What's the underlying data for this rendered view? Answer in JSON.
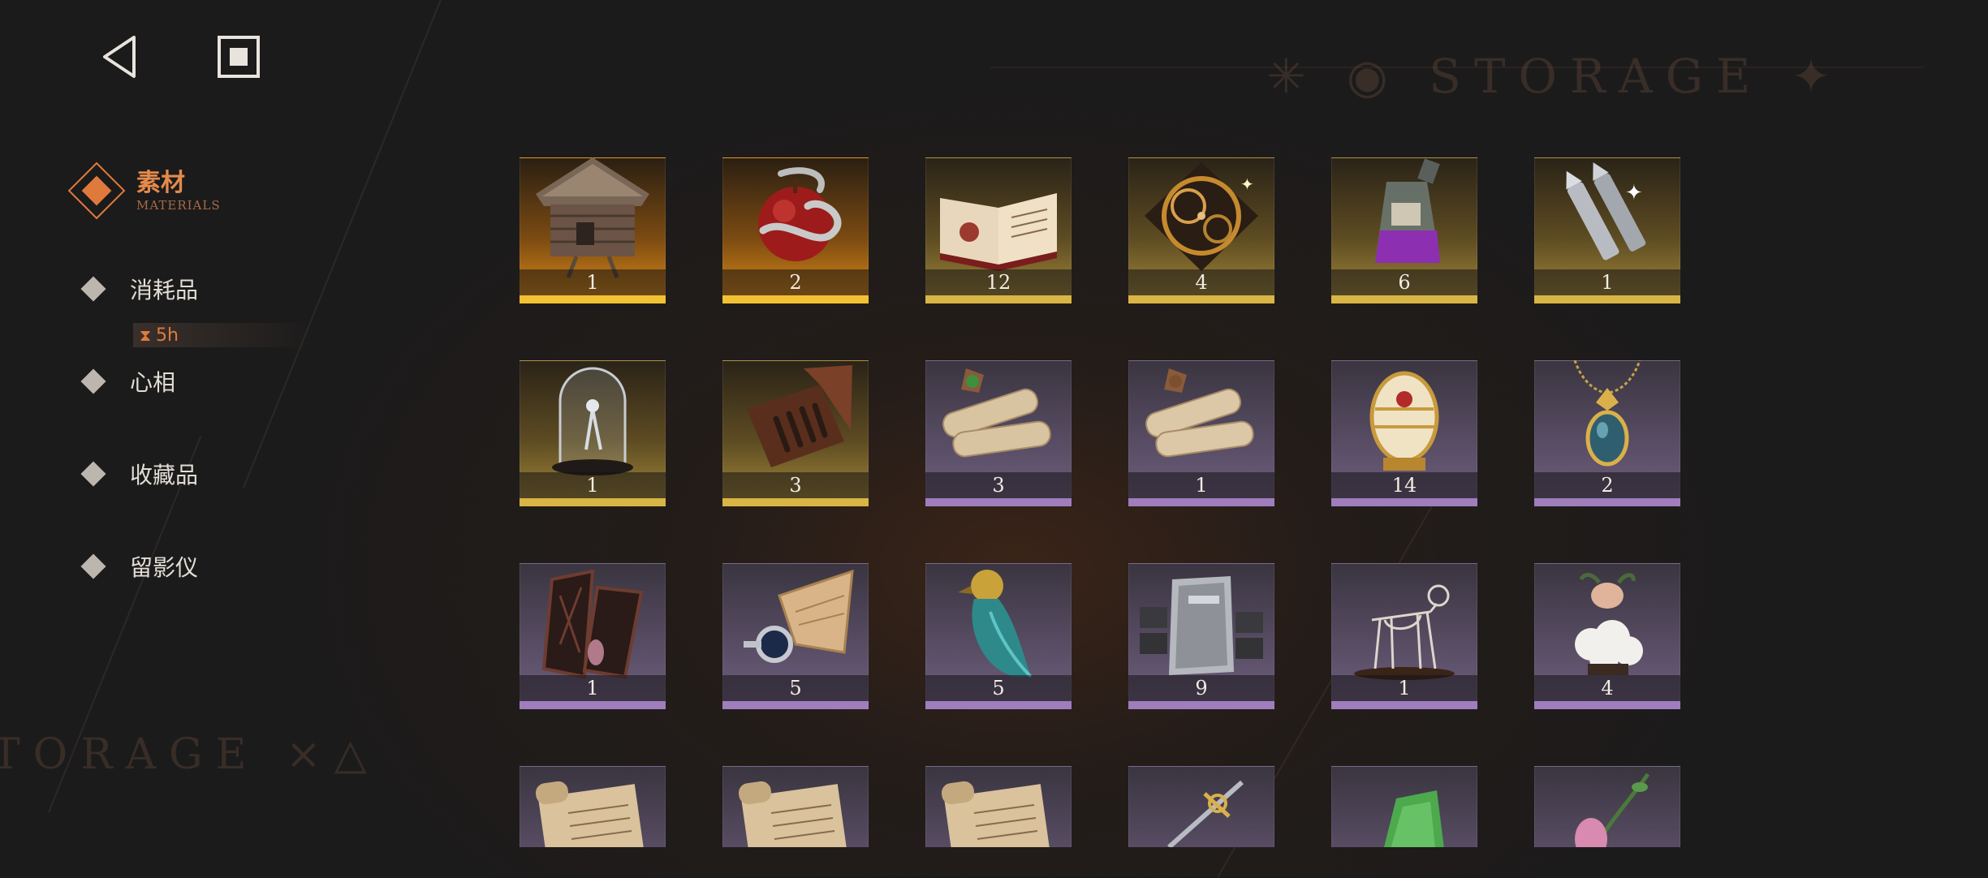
{
  "background": {
    "storage_top": "✳ ◉ STORAGE ✦",
    "storage_left": "TORAGE ×△"
  },
  "nav": {
    "back": "back-triangle",
    "stop": "stop-square"
  },
  "sidebar": {
    "active": {
      "label": "素材",
      "sublabel": "MATERIALS"
    },
    "items": [
      {
        "label": "消耗品",
        "sublabel": ""
      },
      {
        "label": "心相",
        "sublabel": ""
      },
      {
        "label": "收藏品",
        "sublabel": ""
      },
      {
        "label": "留影仪",
        "sublabel": ""
      }
    ],
    "timer": {
      "icon": "hourglass-icon",
      "text": "5h"
    }
  },
  "colors": {
    "accent": "#e07a3c",
    "rarity_gold": "#d9b545",
    "rarity_orange": "#f2c233",
    "rarity_purple": "#a07dbd"
  },
  "items": [
    {
      "name": "hut-on-legs",
      "count": "1",
      "rarity": "orange"
    },
    {
      "name": "apple-with-snake",
      "count": "2",
      "rarity": "orange"
    },
    {
      "name": "open-book",
      "count": "12",
      "rarity": "gold"
    },
    {
      "name": "clockwork-gears",
      "count": "4",
      "rarity": "gold"
    },
    {
      "name": "potion-bottle",
      "count": "6",
      "rarity": "gold"
    },
    {
      "name": "silver-bullets",
      "count": "1",
      "rarity": "gold"
    },
    {
      "name": "glass-dome",
      "count": "1",
      "rarity": "gold"
    },
    {
      "name": "open-case-hand",
      "count": "3",
      "rarity": "gold"
    },
    {
      "name": "scroll-green-seal",
      "count": "3",
      "rarity": "purple"
    },
    {
      "name": "scroll-bundle",
      "count": "1",
      "rarity": "purple"
    },
    {
      "name": "ornate-egg",
      "count": "14",
      "rarity": "purple"
    },
    {
      "name": "amulet-pendant",
      "count": "2",
      "rarity": "purple"
    },
    {
      "name": "wooden-frame-case",
      "count": "1",
      "rarity": "purple"
    },
    {
      "name": "metal-shard",
      "count": "5",
      "rarity": "purple"
    },
    {
      "name": "bird-statue",
      "count": "5",
      "rarity": "purple"
    },
    {
      "name": "silver-bar",
      "count": "9",
      "rarity": "purple"
    },
    {
      "name": "animal-skeleton",
      "count": "1",
      "rarity": "purple"
    },
    {
      "name": "crystal-plant",
      "count": "4",
      "rarity": "purple"
    },
    {
      "name": "paper-scroll",
      "count": "",
      "rarity": "purple"
    },
    {
      "name": "paper-scroll",
      "count": "",
      "rarity": "purple"
    },
    {
      "name": "paper-scroll",
      "count": "",
      "rarity": "purple"
    },
    {
      "name": "sword-hilt",
      "count": "",
      "rarity": "purple"
    },
    {
      "name": "green-gem",
      "count": "",
      "rarity": "purple"
    },
    {
      "name": "flower-branch",
      "count": "",
      "rarity": "purple"
    }
  ]
}
